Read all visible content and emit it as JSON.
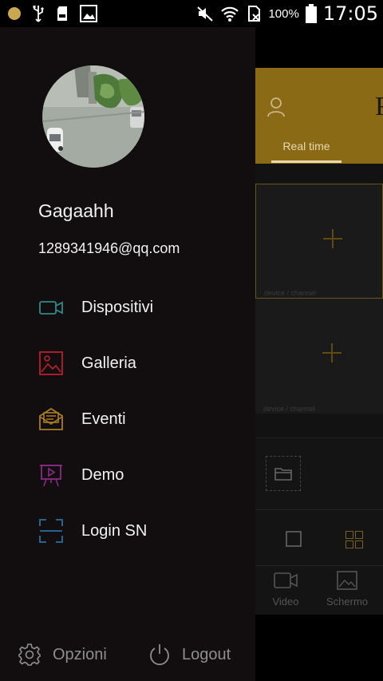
{
  "status_bar": {
    "battery_percent": "100%",
    "time": "17:05"
  },
  "background_app": {
    "header_letter": "R",
    "tab_label": "Real time",
    "cells": [
      {
        "label": "device / channel"
      },
      {
        "label": "device / channel"
      }
    ],
    "bottom_nav": [
      {
        "label": "Video",
        "icon": "video-icon"
      },
      {
        "label": "Schermo",
        "icon": "screen-icon"
      }
    ],
    "accent_color": "#8b6a15"
  },
  "drawer": {
    "user": {
      "name": "Gagaahh",
      "email": "1289341946@qq.com"
    },
    "menu": [
      {
        "label": "Dispositivi",
        "icon": "camera-icon",
        "color": "#2f8a8a"
      },
      {
        "label": "Galleria",
        "icon": "gallery-icon",
        "color": "#b8202e"
      },
      {
        "label": "Eventi",
        "icon": "events-icon",
        "color": "#a97c22"
      },
      {
        "label": "Demo",
        "icon": "demo-icon",
        "color": "#8a2a86"
      },
      {
        "label": "Login SN",
        "icon": "scan-icon",
        "color": "#2a6fa0"
      }
    ],
    "footer": {
      "options_label": "Opzioni",
      "logout_label": "Logout"
    }
  }
}
